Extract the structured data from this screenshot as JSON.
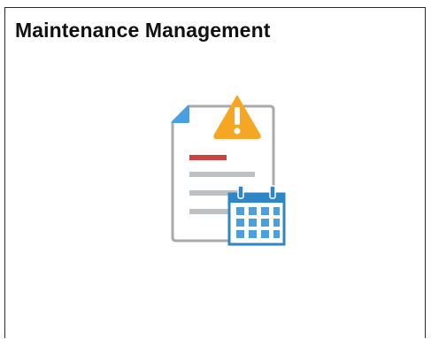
{
  "tile": {
    "title": "Maintenance Management",
    "icon": "document-warning-calendar-icon"
  },
  "colors": {
    "title_text": "#111111",
    "tile_border": "#2b2b2b",
    "document_border": "#a9aaab",
    "document_corner_fold": "#4a9fe0",
    "document_highlight_line": "#c8443c",
    "document_lines": "#bdc1c3",
    "warning_triangle": "#f5a623",
    "calendar": "#2f86c7"
  }
}
